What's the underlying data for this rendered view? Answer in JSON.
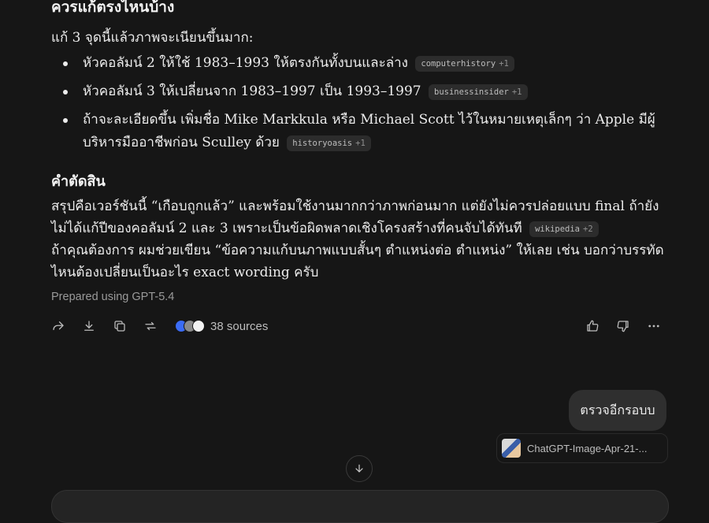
{
  "assistant_message": {
    "top_heading": "ควรแก้ตรงไหนบ้าง",
    "intro": "แก้ 3 จุดนี้แล้วภาพจะเนียนขึ้นมาก:",
    "bullets": [
      {
        "text": "หัวคอลัมน์ 2 ให้ใช้ 1983–1993 ให้ตรงกันทั้งบนและล่าง",
        "chip_source": "computerhistory",
        "chip_more": "+1"
      },
      {
        "text": "หัวคอลัมน์ 3 ให้เปลี่ยนจาก 1983–1997 เป็น 1993–1997",
        "chip_source": "businessinsider",
        "chip_more": "+1"
      },
      {
        "text": "ถ้าจะละเอียดขึ้น เพิ่มชื่อ Mike Markkula หรือ Michael Scott ไว้ในหมายเหตุเล็กๆ ว่า Apple มีผู้บริหารมืออาชีพก่อน Sculley ด้วย",
        "chip_source": "historyoasis",
        "chip_more": "+1"
      }
    ],
    "verdict_heading": "คำตัดสิน",
    "verdict_para1": "สรุปคือเวอร์ชันนี้ “เกือบถูกแล้ว” และพร้อมใช้งานมากกว่าภาพก่อนมาก แต่ยังไม่ควรปล่อยแบบ final ถ้ายังไม่ได้แก้ปีของคอลัมน์ 2 และ 3 เพราะเป็นข้อผิดพลาดเชิงโครงสร้างที่คนจับได้ทันที",
    "verdict_chip_source": "wikipedia",
    "verdict_chip_more": "+2",
    "verdict_para2": "ถ้าคุณต้องการ ผมช่วยเขียน “ข้อความแก้บนภาพแบบสั้นๆ ตำแหน่งต่อ ตำแหน่ง” ให้เลย เช่น บอกว่าบรรทัดไหนต้องเปลี่ยนเป็นอะไร exact wording ครับ",
    "prepared": "Prepared using GPT-5.4",
    "sources_label": "38 sources"
  },
  "user_message": {
    "text": "ตรวจอีกรอบบ",
    "attachment_name": "ChatGPT-Image-Apr-21-..."
  },
  "icons": {
    "share": "share-icon",
    "download": "download-icon",
    "copy": "copy-icon",
    "regenerate": "regenerate-icon",
    "like": "thumbs-up-icon",
    "dislike": "thumbs-down-icon",
    "more": "more-icon",
    "scroll": "arrow-down-icon"
  },
  "colors": {
    "background": "#161616",
    "user_bubble": "#2f2f2f",
    "chip": "#2c2c2c"
  }
}
